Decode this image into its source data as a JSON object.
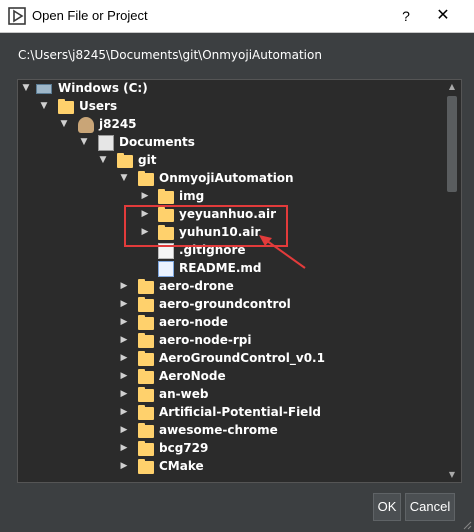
{
  "window": {
    "title": "Open File or Project",
    "help_label": "?",
    "close_label": "✕"
  },
  "path": {
    "value": "C:\\Users\\j8245\\Documents\\git\\OnmyojiAutomation"
  },
  "tree": {
    "items": [
      {
        "label": "Windows (C:)",
        "icon": "drive-icon",
        "expanded": true
      },
      {
        "label": "Users",
        "icon": "folder-icon",
        "expanded": true
      },
      {
        "label": "j8245",
        "icon": "user-folder-icon",
        "expanded": true
      },
      {
        "label": "Documents",
        "icon": "documents-icon",
        "expanded": true
      },
      {
        "label": "git",
        "icon": "folder-icon",
        "expanded": true
      },
      {
        "label": "OnmyojiAutomation",
        "icon": "folder-icon",
        "expanded": true
      },
      {
        "label": "img",
        "icon": "folder-icon",
        "expanded": false
      },
      {
        "label": "yeyuanhuo.air",
        "icon": "folder-icon",
        "expanded": false
      },
      {
        "label": "yuhun10.air",
        "icon": "folder-icon",
        "expanded": false
      },
      {
        "label": ".gitignore",
        "icon": "file-icon"
      },
      {
        "label": "README.md",
        "icon": "markdown-file-icon"
      },
      {
        "label": "aero-drone",
        "icon": "folder-icon",
        "expanded": false
      },
      {
        "label": "aero-groundcontrol",
        "icon": "folder-icon",
        "expanded": false
      },
      {
        "label": "aero-node",
        "icon": "folder-icon",
        "expanded": false
      },
      {
        "label": "aero-node-rpi",
        "icon": "folder-icon",
        "expanded": false
      },
      {
        "label": "AeroGroundControl_v0.1",
        "icon": "folder-icon",
        "expanded": false
      },
      {
        "label": "AeroNode",
        "icon": "folder-icon",
        "expanded": false
      },
      {
        "label": "an-web",
        "icon": "folder-icon",
        "expanded": false
      },
      {
        "label": "Artificial-Potential-Field",
        "icon": "folder-icon",
        "expanded": false
      },
      {
        "label": "awesome-chrome",
        "icon": "folder-icon",
        "expanded": false
      },
      {
        "label": "bcg729",
        "icon": "folder-icon",
        "expanded": false
      },
      {
        "label": "CMake",
        "icon": "folder-icon",
        "expanded": false
      }
    ]
  },
  "buttons": {
    "ok": "OK",
    "cancel": "Cancel"
  },
  "colors": {
    "background": "#3c3f41",
    "tree_background": "#2b2b2b",
    "folder": "#ffd16c",
    "annotation": "#e23b3b"
  }
}
